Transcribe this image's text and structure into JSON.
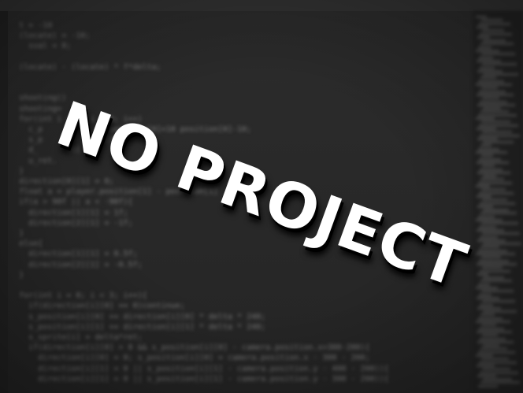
{
  "stamp": {
    "text": "NO PROJECT"
  },
  "code_lines": [
    "    t = -10",
    "    (locate) = -10;",
    "      sval = 0;",
    "",
    "    (locate) - (locate) * f*delta;",
    "",
    "",
    "    shooting()",
    "    shooting=",
    "    for(int i = 0; i < 3; i++)",
    "      c_p         = at.position[0]+10 position[0]-10;",
    "      s_p        ition[1]",
    "      d_      it(",
    "      u_ret.",
    "    }",
    "    direction[0][1] = 0;",
    "    float a = player.position[1] - position[1]",
    "    if(a > 90f || a < -90f){",
    "      direction[1][1] = 1f;",
    "      direction[2][1] = -1f;",
    "    }",
    "    else{",
    "      direction[1][1] = 0.5f;",
    "      direction[2][1] = -0.5f;",
    "    }",
    "",
    "    for(int i = 0; i < 3; i++){",
    "      if(direction[i][0] == 0)continue;",
    "      s_position[i][0] += direction[i][0] * delta * 240;",
    "      s_position[i][1] += direction[i][1] * delta * 240;",
    "      s_sprite[i] = delta*ret;",
    "      if(direction[i][0] > 0 && s_position[i][0] - camera.position.x>300-200){",
    "        direction[i][0] = 0; s_position[i][0] = camera.position.x - 300 - 200;",
    "        direction[i][1] = 0 || s_position[i][1] - camera.position.y - 400 - 200)){",
    "        direction[i][1] = 0 || s_position[i][1] - camera.position.y - 300 - 200)){"
  ]
}
